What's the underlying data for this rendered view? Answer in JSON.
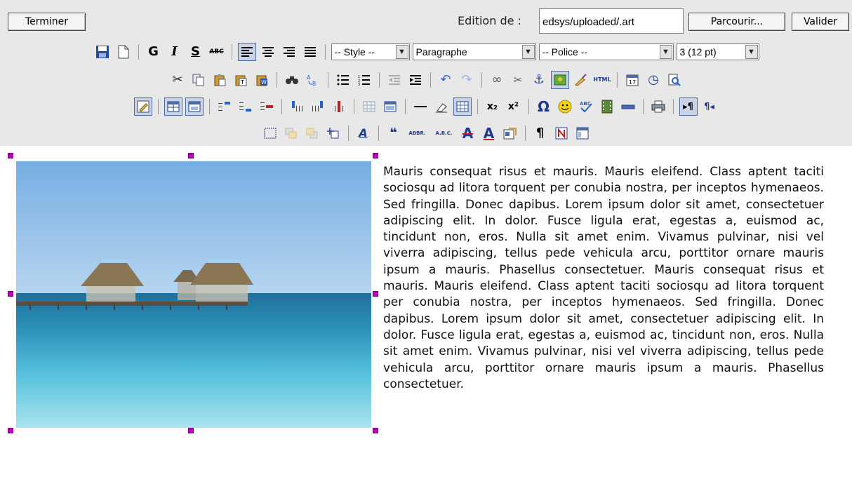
{
  "topbar": {
    "finish_label": "Terminer",
    "edition_label": "Edition de :",
    "path_value": "edsys/uploaded/.art",
    "browse_label": "Parcourir...",
    "validate_label": "Valider"
  },
  "toolbar": {
    "style_select": "-- Style --",
    "format_select": "Paragraphe",
    "font_select": "-- Police --",
    "size_select": "3 (12 pt)",
    "bold_glyph": "G",
    "italic_glyph": "I",
    "underline_glyph": "S",
    "strike_glyph": "ABC",
    "html_glyph": "HTML",
    "abbr_glyph": "ABBR.",
    "acronym_glyph": "A.B.C.",
    "sub_glyph": "x₂",
    "sup_glyph": "x²",
    "spell_glyph": "ABC"
  },
  "content": {
    "paragraph": "Mauris consequat risus et mauris. Mauris eleifend. Class aptent taciti sociosqu ad litora torquent per conubia nostra, per inceptos hymenaeos. Sed fringilla. Donec dapibus. Lorem ipsum dolor sit amet, consectetuer adipiscing elit. In dolor. Fusce ligula erat, egestas a, euismod ac, tincidunt non, eros. Nulla sit amet enim. Vivamus pulvinar, nisi vel viverra adipiscing, tellus pede vehicula arcu, porttitor ornare mauris ipsum a mauris. Phasellus consectetuer. Mauris consequat risus et mauris. Mauris eleifend. Class aptent taciti sociosqu ad litora torquent per conubia nostra, per inceptos hymenaeos. Sed fringilla. Donec dapibus. Lorem ipsum dolor sit amet, consectetuer adipiscing elit. In dolor. Fusce ligula erat, egestas a, euismod ac, tincidunt non, eros. Nulla sit amet enim. Vivamus pulvinar, nisi vel viverra adipiscing, tellus pede vehicula arcu, porttitor ornare mauris ipsum a mauris. Phasellus consectetuer."
  },
  "colors": {
    "toolbar_bg": "#e8e8e8",
    "handle": "#c000c0",
    "icon_blue": "#1f3a8a"
  }
}
